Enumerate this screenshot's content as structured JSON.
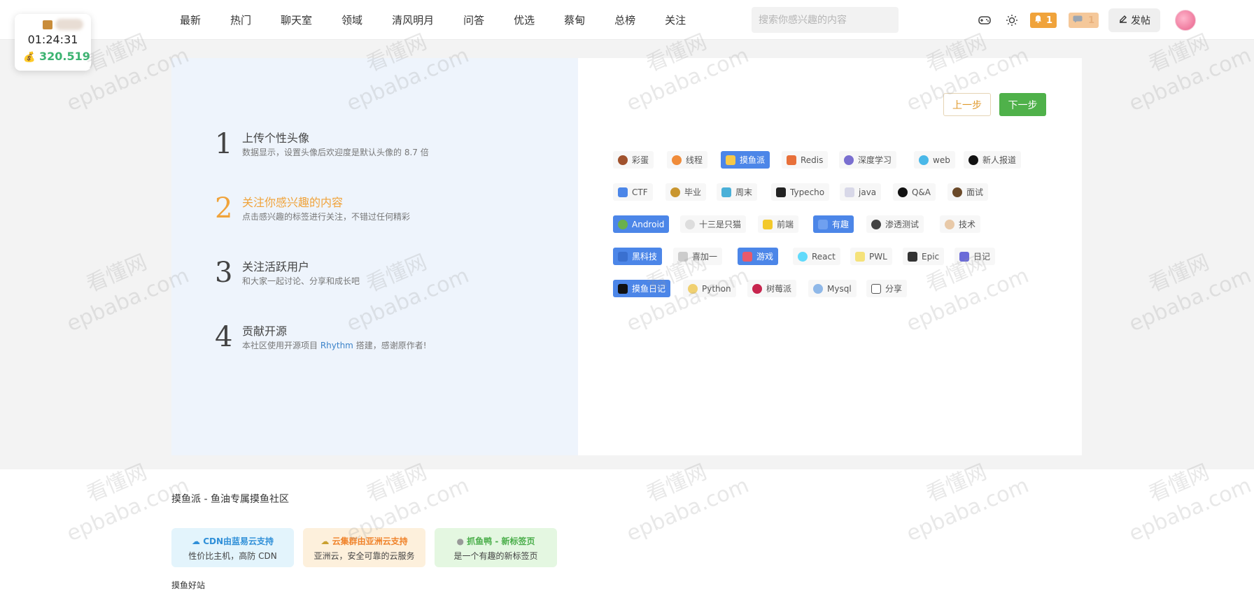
{
  "header": {
    "nav": [
      "最新",
      "热门",
      "聊天室",
      "领域",
      "清风明月",
      "问答",
      "优选",
      "蔡甸",
      "总榜",
      "关注"
    ],
    "search_placeholder": "搜索你感兴趣的内容",
    "notification_count": "1",
    "message_count": "1",
    "post_label": "发帖"
  },
  "float_card": {
    "timer": "01:24:31",
    "points": "320.519"
  },
  "steps": [
    {
      "num": "1",
      "title": "上传个性头像",
      "desc": "数据显示，设置头像后欢迎度是默认头像的 8.7 倍"
    },
    {
      "num": "2",
      "title": "关注你感兴趣的内容",
      "desc": "点击感兴趣的标签进行关注，不错过任何精彩"
    },
    {
      "num": "3",
      "title": "关注活跃用户",
      "desc": "和大家一起讨论、分享和成长吧"
    },
    {
      "num": "4",
      "title": "贡献开源",
      "desc_before": "本社区使用开源项目 ",
      "desc_link": "Rhythm",
      "desc_after": " 搭建，感谢原作者!"
    }
  ],
  "wizard": {
    "prev_label": "上一步",
    "next_label": "下一步"
  },
  "tags": [
    [
      "彩蛋",
      "线程",
      "摸鱼派",
      "Redis",
      "深度学习",
      "web",
      "新人报道"
    ],
    [
      "CTF",
      "毕业",
      "周末",
      "Typecho",
      "java",
      "Q&A",
      "面试"
    ],
    [
      "Android",
      "十三是只猫",
      "前端",
      "有趣",
      "渗透测试",
      "技术"
    ],
    [
      "黑科技",
      "喜加一",
      "游戏",
      "React",
      "PWL",
      "Epic",
      "日记"
    ],
    [
      "摸鱼日记",
      "Python",
      "树莓派",
      "Mysql",
      "分享"
    ]
  ],
  "footer": {
    "site_title": "摸鱼派 - 鱼油专属摸鱼社区",
    "sponsors": [
      {
        "title": "CDN由蓝易云支持",
        "desc": "性价比主机，高防 CDN",
        "color": "#2f8fd8",
        "bg": "#e3f4fc"
      },
      {
        "title": "云集群由亚洲云支持",
        "desc": "亚洲云，安全可靠的云服务",
        "color": "#f0832b",
        "bg": "#fdf0dc"
      },
      {
        "title": "抓鱼鸭 - 新标签页",
        "desc": "是一个有趣的新标签页",
        "color": "#4aae4a",
        "bg": "#e4f7e1"
      }
    ],
    "sites_title": "摸鱼好站"
  },
  "watermark": {
    "line1": "看懂网",
    "line2": "epbaba.com"
  },
  "colors": {
    "accent_orange": "#f0a33b",
    "next_green": "#4fb14a",
    "selected_blue": "#4c86e8"
  }
}
